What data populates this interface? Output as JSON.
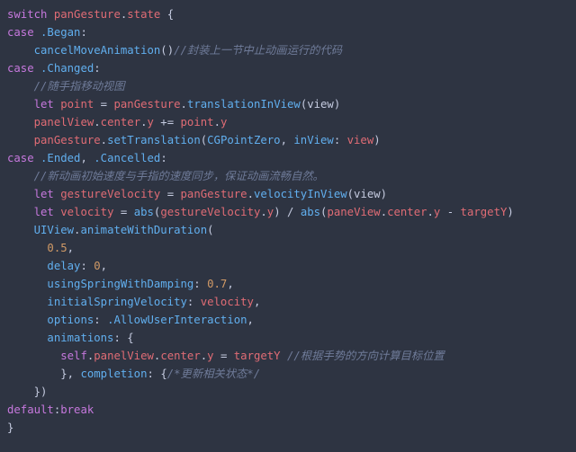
{
  "code": {
    "l01": {
      "switch": "switch",
      "expr1": "panGesture",
      "dot": ".",
      "expr2": "state",
      "brace": " {"
    },
    "l02": {
      "case": "case",
      "enum": ".Began",
      "colon": ":"
    },
    "l03": {
      "fn": "cancelMoveAnimation",
      "paren": "()",
      "cmt": "//封装上一节中止动画运行的代码"
    },
    "l04": {
      "case": "case",
      "enum": ".Changed",
      "colon": ":"
    },
    "l05": {
      "cmt": "//随手指移动视图"
    },
    "l06": {
      "let": "let",
      "name": "point",
      "eq": " = ",
      "obj": "panGesture",
      "dot": ".",
      "fn": "translationInView",
      "args": "(view)"
    },
    "l07": {
      "a": "panelView",
      "d1": ".",
      "b": "center",
      "d2": ".",
      "c": "y",
      "op": " += ",
      "r1": "point",
      "d3": ".",
      "r2": "y"
    },
    "l08": {
      "obj": "panGesture",
      "dot": ".",
      "fn": "setTranslation",
      "open": "(",
      "arg1": "CGPointZero",
      "comma": ", ",
      "lbl": "inView",
      "col": ": ",
      "arg2": "view",
      "close": ")"
    },
    "l09": {
      "case": "case",
      "enum1": ".Ended",
      "comma": ", ",
      "enum2": ".Cancelled",
      "colon": ":"
    },
    "l10": {
      "cmt": "//新动画初始速度与手指的速度同步，保证动画流畅自然。"
    },
    "l11": {
      "let": "let",
      "name": "gestureVelocity",
      "eq": " = ",
      "obj": "panGesture",
      "dot": ".",
      "fn": "velocityInView",
      "args": "(view)"
    },
    "l12": {
      "let": "let",
      "name": "velocity",
      "eq": " = ",
      "fn1": "abs",
      "o1": "(",
      "a1": "gestureVelocity",
      "d1": ".",
      "a1b": "y",
      "c1": ")",
      "op": " / ",
      "fn2": "abs",
      "o2": "(",
      "b1": "paneView",
      "d2": ".",
      "b2": "center",
      "d3": ".",
      "b3": "y",
      "op2": " - ",
      "t": "targetY",
      "c2": ")"
    },
    "l13": {
      "obj": "UIView",
      "dot": ".",
      "fn": "animateWithDuration",
      "open": "("
    },
    "l14": {
      "num": "0.5",
      "comma": ","
    },
    "l15": {
      "lbl": "delay",
      "col": ": ",
      "num": "0",
      "comma": ","
    },
    "l16": {
      "lbl": "usingSpringWithDamping",
      "col": ": ",
      "num": "0.7",
      "comma": ","
    },
    "l17": {
      "lbl": "initialSpringVelocity",
      "col": ": ",
      "val": "velocity",
      "comma": ","
    },
    "l18": {
      "lbl": "options",
      "col": ": ",
      "val": ".AllowUserInteraction",
      "comma": ","
    },
    "l19": {
      "lbl": "animations",
      "col": ": ",
      "brace": "{"
    },
    "l20": {
      "self": "self",
      "d1": ".",
      "a": "panelView",
      "d2": ".",
      "b": "center",
      "d3": ".",
      "c": "y",
      "eq": " = ",
      "t": "targetY",
      "sp": " ",
      "cmt": "//根据手势的方向计算目标位置"
    },
    "l21": {
      "close1": "}",
      "comma": ", ",
      "lbl": "completion",
      "col": ": ",
      "open": "{",
      "cmt": "/*更新相关状态*/"
    },
    "l22": {
      "close": "})"
    },
    "l23": {
      "default": "default",
      "colon": ":",
      "break": "break"
    },
    "l24": {
      "brace": "}"
    }
  }
}
